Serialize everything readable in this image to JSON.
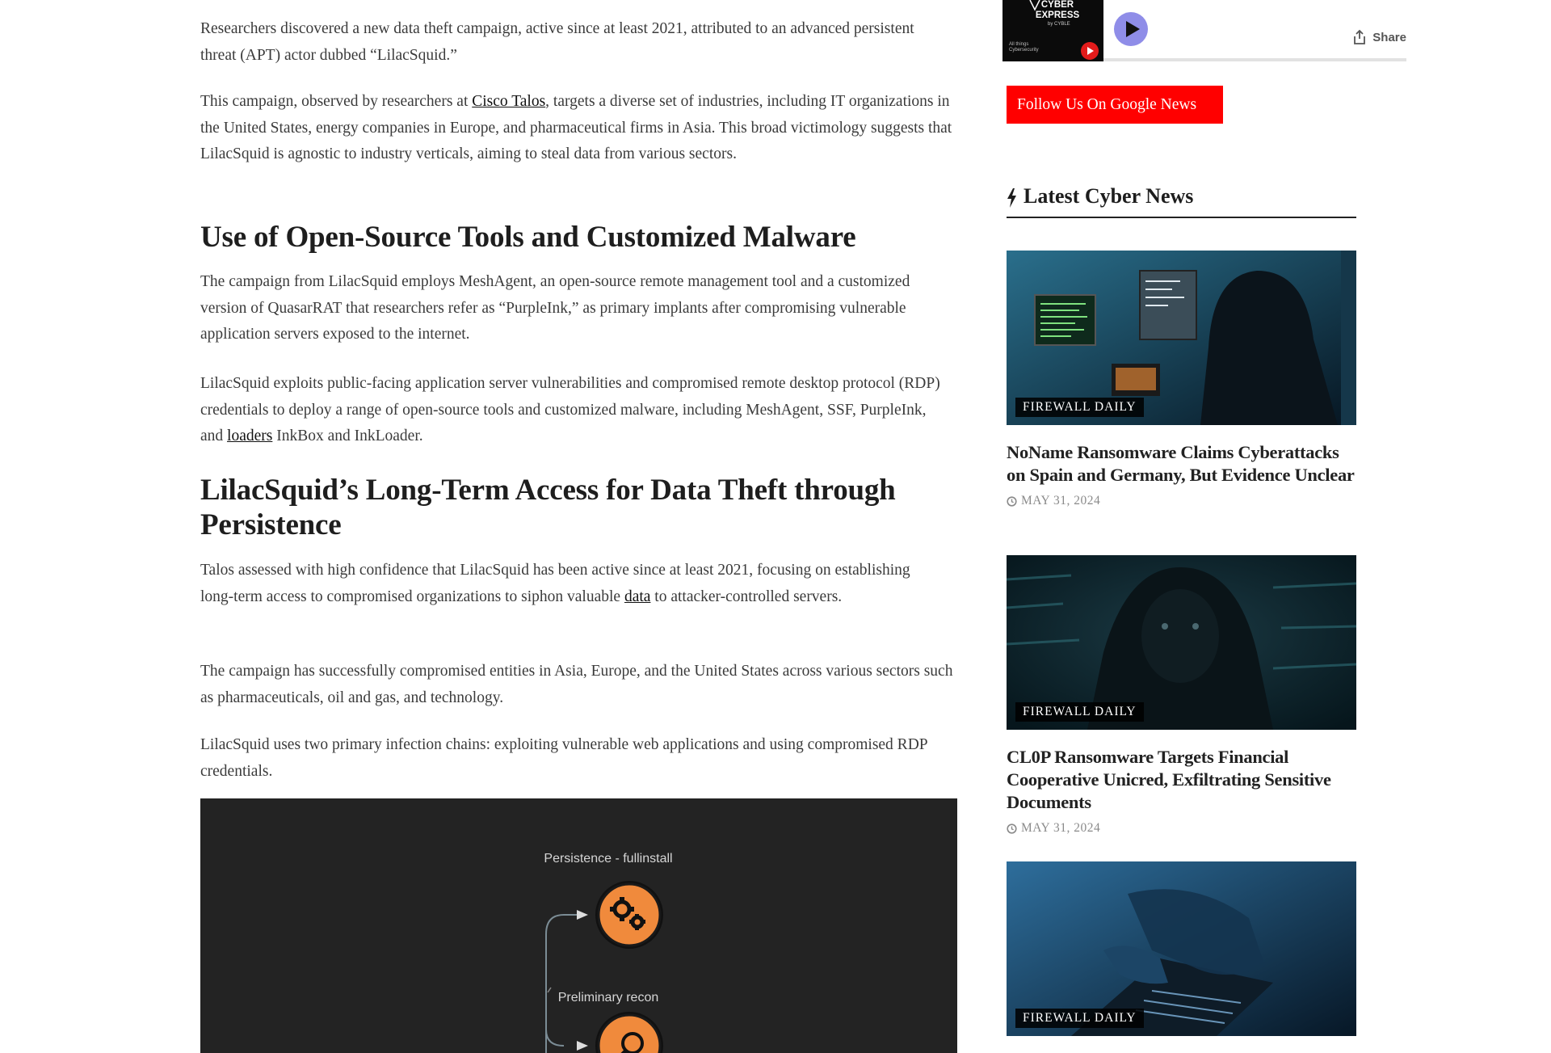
{
  "article": {
    "p1": "Researchers discovered a new data theft campaign, active since at least 2021, attributed to an advanced persistent threat (APT) actor dubbed “LilacSquid.”",
    "p2": {
      "before": "This campaign, observed by researchers at ",
      "link": "Cisco Talos",
      "after": ", targets a diverse set of industries, including IT organizations in the United States, energy companies in Europe, and pharmaceutical firms in Asia. This broad victimology suggests that LilacSquid is agnostic to industry verticals, aiming to steal data from various sectors."
    },
    "h2_1": "Use of Open-Source Tools and Customized Malware",
    "p3": "The campaign from LilacSquid employs MeshAgent, an open-source remote management tool and a customized version of QuasarRAT that researchers refer as “PurpleInk,” as primary implants after compromising vulnerable application servers exposed to the internet.",
    "p4": {
      "before": "LilacSquid exploits public-facing application server vulnerabilities and compromised remote desktop protocol (RDP) credentials to deploy a range of open-source tools and customized malware, including MeshAgent, SSF, PurpleInk, and ",
      "link": "loaders",
      "after": " InkBox and InkLoader."
    },
    "h2_2": "LilacSquid’s Long-Term Access for Data Theft through Persistence",
    "p5": {
      "before": "Talos assessed with high confidence that LilacSquid has been active since at least 2021, focusing on establishing long-term access to compromised organizations to siphon valuable ",
      "link": "data",
      "after": " to attacker-controlled servers."
    },
    "p6": "The campaign has successfully compromised entities in Asia, Europe, and the United States across various sectors such as pharmaceuticals, oil and gas, and technology.",
    "p7": "LilacSquid uses two primary infection chains: exploiting vulnerable web applications and using compromised RDP credentials."
  },
  "diagram": {
    "label_persistence": "Persistence - fullinstall",
    "label_recon": "Preliminary recon",
    "node_color": "#f08a3c",
    "background": "#232323"
  },
  "sidebar": {
    "podcast": {
      "thumb_title": "CYBER EXPRESS",
      "thumb_by": "by CYBLE",
      "thumb_tagline": "All things Cybersecurity",
      "share_label": "Share",
      "play_color": "#8f8de8"
    },
    "google_news_button": "Follow Us On Google News",
    "latest_title": "Latest Cyber News",
    "cards": [
      {
        "badge": "FIREWALL DAILY",
        "headline": "NoName Ransomware Claims Cyberattacks on Spain and Germany, But Evidence Unclear",
        "date": "MAY 31, 2024"
      },
      {
        "badge": "FIREWALL DAILY",
        "headline": "CL0P Ransomware Targets Financial Cooperative Unicred, Exfiltrating Sensitive Documents",
        "date": "MAY 31, 2024"
      },
      {
        "badge": "FIREWALL DAILY"
      }
    ]
  },
  "colors": {
    "accent_red": "#ff0000",
    "text": "#3b3b3b",
    "heading": "#1e1e1e"
  }
}
